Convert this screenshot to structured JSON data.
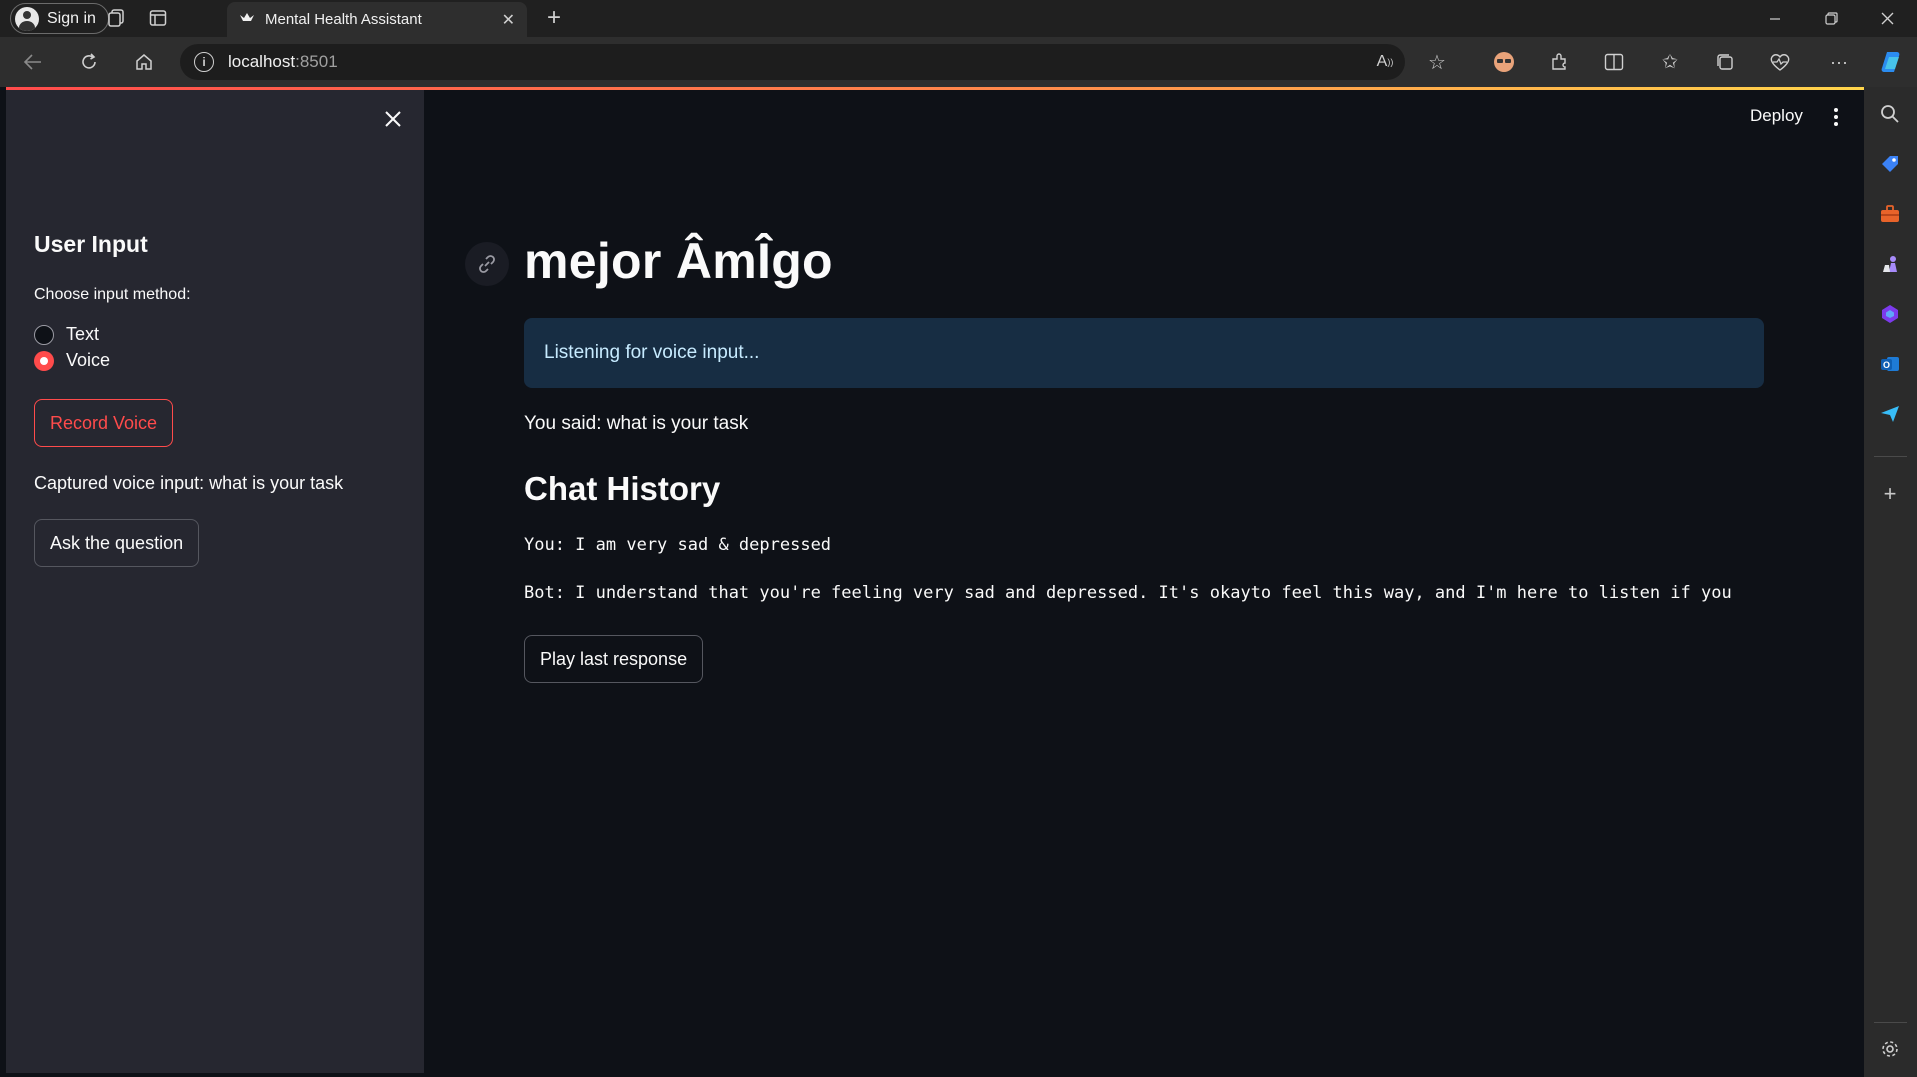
{
  "browser": {
    "signin_label": "Sign in",
    "tab_title": "Mental Health Assistant",
    "url_host": "localhost",
    "url_port": ":8501"
  },
  "sidebar": {
    "heading": "User Input",
    "input_method_label": "Choose input method:",
    "options": [
      {
        "label": "Text",
        "selected": false
      },
      {
        "label": "Voice",
        "selected": true
      }
    ],
    "record_button": "Record Voice",
    "captured_text": "Captured voice input: what is your task",
    "ask_button": "Ask the question"
  },
  "header": {
    "deploy_label": "Deploy"
  },
  "main": {
    "title": "mejor ÂmÎgo",
    "info_message": "Listening for voice input...",
    "you_said": "You said: what is your task",
    "history_title": "Chat History",
    "chat": [
      {
        "text": "You: I am very sad & depressed"
      },
      {
        "text": "Bot: I understand that you're feeling very sad and depressed. It's okayto feel this way, and I'm here to listen if you"
      }
    ],
    "play_button": "Play last response"
  },
  "colors": {
    "app_bg": "#0e1117",
    "sidebar_bg": "#262730",
    "accent": "#ff4b4b",
    "info_bg": "#172d43",
    "info_text": "#c7ebff"
  },
  "icons": [
    "profile-icon",
    "workspaces-icon",
    "tab-actions-icon",
    "crown-favicon",
    "close-icon",
    "plus-icon",
    "minimize-icon",
    "restore-icon",
    "back-icon",
    "refresh-icon",
    "home-icon",
    "info-icon",
    "read-aloud-icon",
    "favorite-star-icon",
    "extension-icon",
    "split-screen-icon",
    "favorites-icon",
    "collections-icon",
    "health-icon",
    "more-icon",
    "copilot-icon",
    "link-icon",
    "kebab-menu-icon",
    "search-icon",
    "tag-icon",
    "toolbox-icon",
    "chess-icon",
    "office-icon",
    "outlook-icon",
    "send-icon",
    "settings-icon"
  ]
}
